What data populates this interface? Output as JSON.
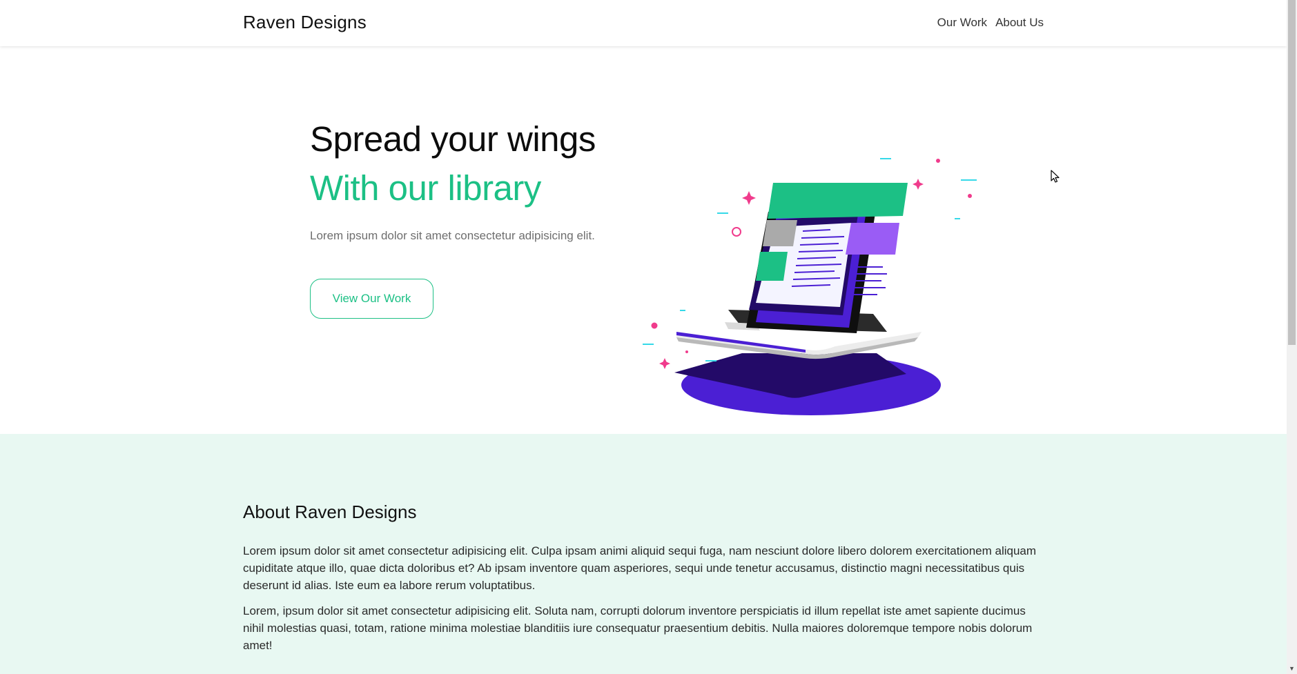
{
  "navbar": {
    "brand": "Raven Designs",
    "links": [
      "Our Work",
      "About Us"
    ]
  },
  "hero": {
    "title": "Spread your wings",
    "subtitle": "With our library",
    "text": "Lorem ipsum dolor sit amet consectetur adipisicing elit.",
    "button_label": "View Our Work",
    "illustration": "laptop-illustration"
  },
  "about": {
    "title": "About Raven Designs",
    "paragraphs": [
      "Lorem ipsum dolor sit amet consectetur adipisicing elit. Culpa ipsam animi aliquid sequi fuga, nam nesciunt dolore libero dolorem exercitationem aliquam cupiditate atque illo, quae dicta doloribus et? Ab ipsam inventore quam asperiores, sequi unde tenetur accusamus, distinctio magni necessitatibus quis deserunt id alias. Iste eum ea labore rerum voluptatibus.",
      "Lorem, ipsum dolor sit amet consectetur adipisicing elit. Soluta nam, corrupti dolorum inventore perspiciatis id illum repellat iste amet sapiente ducimus nihil molestias quasi, totam, ratione minima molestiae blanditiis iure consequatur praesentium debitis. Nulla maiores doloremque tempore nobis dolorum amet!"
    ]
  },
  "colors": {
    "accent": "#1cc085",
    "about_background": "#e8f8f2",
    "purple": "#4b1fd4",
    "dark_purple": "#230a68",
    "pink": "#f03b8c",
    "cyan": "#35d9e8"
  }
}
